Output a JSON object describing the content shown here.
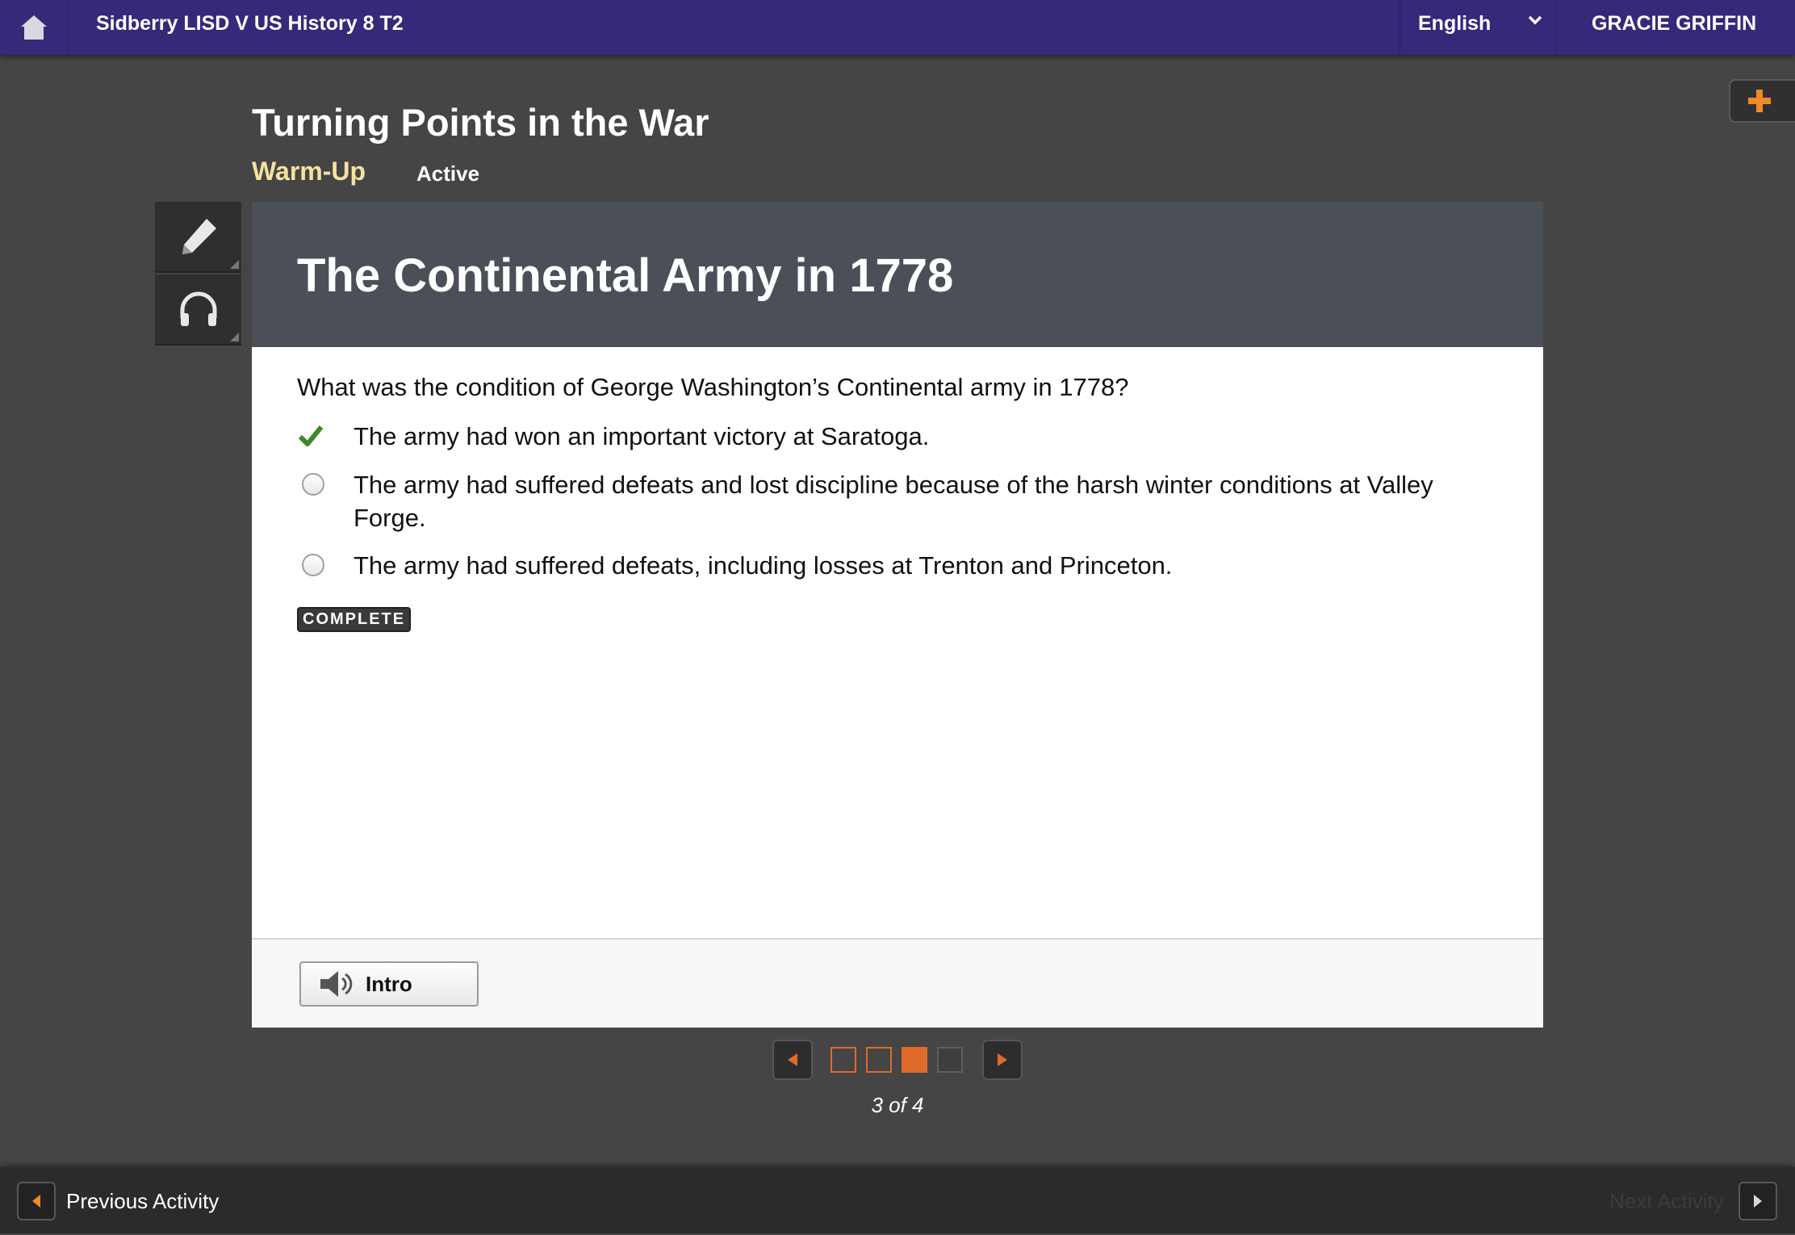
{
  "topbar": {
    "course_title": "Sidberry LISD V US History 8 T2",
    "language": "English",
    "user_name": "GRACIE GRIFFIN"
  },
  "lesson": {
    "title": "Turning Points in the War",
    "activity_type": "Warm-Up",
    "status": "Active"
  },
  "card": {
    "title": "The Continental Army in 1778",
    "question": "What was the condition of George Washington’s Continental army in 1778?",
    "options": [
      {
        "text": "The army had won an important victory at Saratoga.",
        "state": "correct-checked"
      },
      {
        "text": "The army had suffered defeats and lost discipline because of the harsh winter conditions at Valley Forge.",
        "state": "unselected"
      },
      {
        "text": "The army had suffered defeats, including losses at Trenton and Princeton.",
        "state": "unselected"
      }
    ],
    "badge": "COMPLETE",
    "intro_button": "Intro"
  },
  "pager": {
    "current": 3,
    "total": 4,
    "label": "3 of 4"
  },
  "bottombar": {
    "previous_label": "Previous Activity",
    "next_label": "Next Activity"
  },
  "colors": {
    "topbar": "#35297a",
    "accent": "#e06a2a",
    "warmup": "#f3e3a0",
    "check": "#3a8a2a"
  },
  "icons": [
    "home-icon",
    "chevron-down-icon",
    "plus-icon",
    "pencil-icon",
    "headphones-icon",
    "check-icon",
    "speaker-icon",
    "arrow-left-icon",
    "arrow-right-icon"
  ]
}
